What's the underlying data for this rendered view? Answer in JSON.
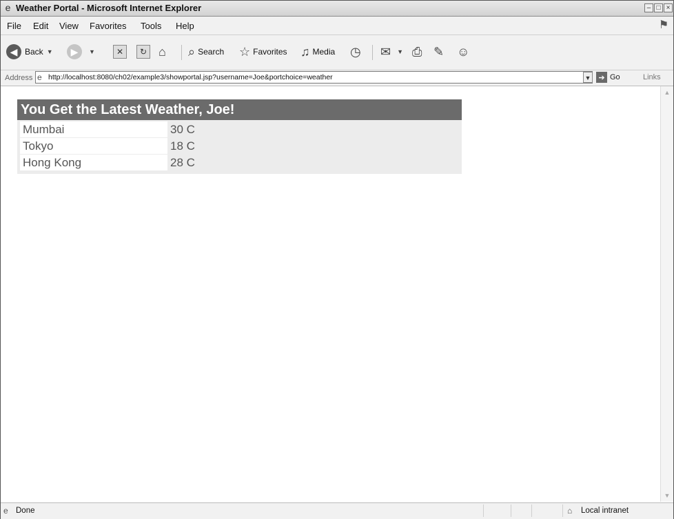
{
  "window": {
    "title": "Weather Portal - Microsoft Internet Explorer",
    "controls": [
      "–",
      "□",
      "×"
    ]
  },
  "menu": [
    "File",
    "Edit",
    "View",
    "Favorites",
    "Tools",
    "Help"
  ],
  "toolbar": {
    "back_label": "Back",
    "search_label": "Search",
    "favorites_label": "Favorites",
    "media_label": "Media"
  },
  "address": {
    "label": "Address",
    "url": "http://localhost:8080/ch02/example3/showportal.jsp?username=Joe&portchoice=weather",
    "go_label": "Go",
    "links_label": "Links"
  },
  "portal": {
    "heading": "You Get the Latest Weather, Joe!",
    "rows": [
      {
        "city": "Mumbai",
        "temp": "30 C"
      },
      {
        "city": "Tokyo",
        "temp": "18 C"
      },
      {
        "city": "Hong Kong",
        "temp": "28 C"
      }
    ]
  },
  "status": {
    "text": "Done",
    "zone": "Local intranet"
  }
}
